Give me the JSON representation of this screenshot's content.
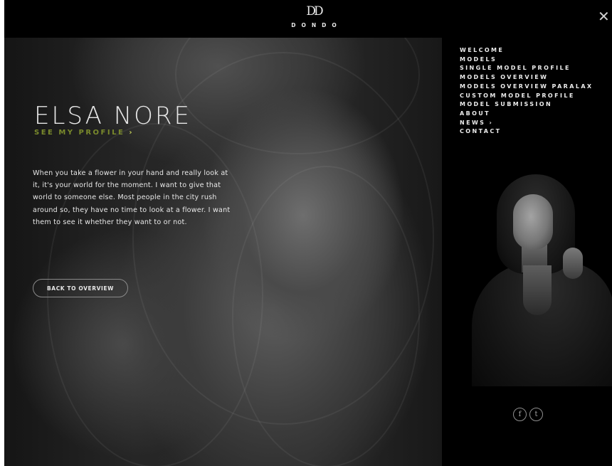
{
  "brand": {
    "mark": "DD",
    "name": "DONDO"
  },
  "close_symbol": "✕",
  "hero": {
    "model_name": "ELSA NORE",
    "profile_link": "SEE MY PROFILE",
    "profile_arrow": "›",
    "bio": "When you take a flower in your hand and really look at it, it's your world for the moment. I want to give that world to someone else. Most people in the city rush around so, they have no time to look at a flower. I want them to see it whether they want to or not.",
    "back_button": "BACK TO OVERVIEW"
  },
  "menu": {
    "items": [
      "WELCOME",
      "MODELS",
      "SINGLE MODEL PROFILE",
      "MODELS OVERVIEW",
      "MODELS OVERVIEW PARALAX",
      "CUSTOM MODEL PROFILE",
      "MODEL SUBMISSION",
      "ABOUT",
      "NEWS  ›",
      "CONTACT"
    ]
  },
  "social": {
    "facebook_glyph": "f",
    "twitter_glyph": "t",
    "icons": [
      "facebook-icon",
      "twitter-icon"
    ]
  },
  "colors": {
    "accent_green": "#7a8a2c",
    "background": "#000000",
    "text": "#e8e8e8"
  }
}
